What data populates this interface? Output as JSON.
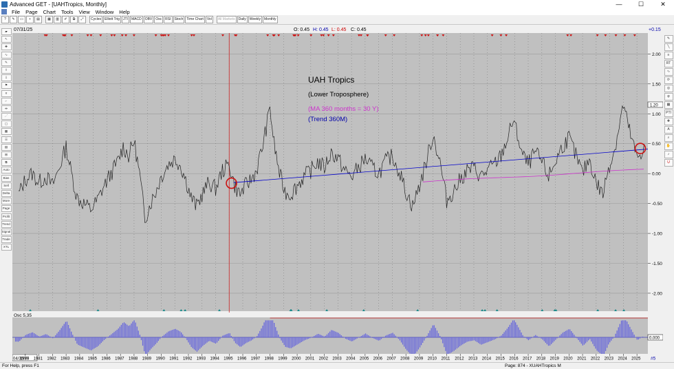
{
  "window": {
    "title": "Advanced GET - [UAHTropics, Monthly]",
    "minimize": "—",
    "maximize": "☐",
    "close": "✕"
  },
  "menu": [
    "File",
    "Page",
    "Chart",
    "Tools",
    "View",
    "Window",
    "Help"
  ],
  "toolbar": [
    "Cycles",
    "Elliott Trig",
    "JTI",
    "MACD",
    "OBV",
    "Osc",
    "RSI",
    "Stoch",
    "Time Chart",
    "Vol",
    "All Markets",
    "Daily",
    "Weekly",
    "Monthly"
  ],
  "left_tools": [
    "Auto Trend",
    "Bias",
    "Sell Stat",
    "Delta",
    "More Arrs",
    "Page",
    "Profit",
    "Trend Chan",
    "Signal Trade",
    "Trade Profile",
    "XTL"
  ],
  "right_tools": [
    "RT",
    "PTI",
    "A"
  ],
  "header": {
    "date": "07/31/25",
    "open": "O: 0.45",
    "high": "H: 0.45",
    "low": "L: 0.45",
    "close": "C: 0.45",
    "change": "+0.15"
  },
  "annotations": {
    "title": "UAH Tropics",
    "subtitle": "(Lower Troposphere)",
    "ma_label": "(MA 360 months = 30 Y)",
    "trend_label": "(Trend 360M)"
  },
  "price_axis": [
    "2.00",
    "1.50",
    "1.00",
    "0.50",
    "0.00",
    "-0.50",
    "-1.00",
    "-1.50",
    "-2.00"
  ],
  "price_marker": "1.20",
  "osc": {
    "label": "Osc 5,35",
    "axis_label": "0.000"
  },
  "time_axis": {
    "start": "04/30/79",
    "years": [
      "1980",
      "1981",
      "1982",
      "1983",
      "1984",
      "1985",
      "1986",
      "1987",
      "1988",
      "1989",
      "1990",
      "1991",
      "1992",
      "1993",
      "1994",
      "1995",
      "1996",
      "1997",
      "1998",
      "1999",
      "2000",
      "2001",
      "2002",
      "2003",
      "2004",
      "2005",
      "2006",
      "2007",
      "2008",
      "2009",
      "2010",
      "2011",
      "2012",
      "2013",
      "2014",
      "2015",
      "2016",
      "2017",
      "2018",
      "2019",
      "2020",
      "2021",
      "2022",
      "2023",
      "2024",
      "2025"
    ],
    "page_number": "#5"
  },
  "status": {
    "help": "For Help, press F1",
    "page": "Page: 874 - XUAHTropics M"
  },
  "colors": {
    "chart_bg": "#c0c0c0",
    "price_line": "#202020",
    "trend": "#0000cc",
    "ma": "#cc33cc",
    "cursor": "#cc2222",
    "osc_bar": "#6666dd",
    "osc_line": "#cc2222",
    "marker_red": "#cc1111",
    "marker_teal": "#1a8a8a"
  },
  "chart_data": {
    "type": "line",
    "ylim": [
      -2.3,
      2.35
    ],
    "xlim": [
      "1979-04",
      "2025-07"
    ],
    "trend_line": {
      "x": [
        "1995-05",
        "2025-07"
      ],
      "y": [
        -0.15,
        0.36
      ]
    },
    "ma_line": {
      "x": [
        "2009-04",
        "2025-07"
      ],
      "y": [
        -0.14,
        0.07
      ]
    },
    "cursor_date": "1995-01",
    "highlight_circles": [
      {
        "x": "1995-03",
        "y": -0.16
      },
      {
        "x": "2025-04",
        "y": 0.42
      }
    ],
    "x": [
      1979.5,
      1980.0,
      1980.5,
      1981.0,
      1981.5,
      1982.0,
      1982.5,
      1983.0,
      1983.4,
      1983.8,
      1984.3,
      1984.8,
      1985.3,
      1985.8,
      1986.3,
      1986.8,
      1987.2,
      1987.6,
      1988.0,
      1988.4,
      1988.8,
      1989.2,
      1989.6,
      1990.0,
      1990.5,
      1991.0,
      1991.4,
      1991.8,
      1992.2,
      1992.6,
      1993.0,
      1993.5,
      1994.0,
      1994.5,
      1995.0,
      1995.4,
      1995.8,
      1996.2,
      1996.6,
      1997.0,
      1997.4,
      1997.8,
      1998.0,
      1998.3,
      1998.7,
      1999.1,
      1999.5,
      2000.0,
      2000.5,
      2001.0,
      2001.5,
      2002.0,
      2002.5,
      2003.0,
      2003.5,
      2004.0,
      2004.5,
      2005.0,
      2005.5,
      2006.0,
      2006.5,
      2007.0,
      2007.5,
      2008.0,
      2008.5,
      2009.0,
      2009.5,
      2010.0,
      2010.5,
      2011.0,
      2011.5,
      2012.0,
      2012.5,
      2013.0,
      2013.5,
      2014.0,
      2014.5,
      2015.0,
      2015.5,
      2015.9,
      2016.2,
      2016.6,
      2017.0,
      2017.5,
      2018.0,
      2018.5,
      2019.0,
      2019.5,
      2020.0,
      2020.5,
      2021.0,
      2021.5,
      2022.0,
      2022.5,
      2022.9,
      2023.3,
      2023.7,
      2024.0,
      2024.3,
      2024.7,
      2025.0,
      2025.3,
      2025.6
    ],
    "y": [
      -0.35,
      -0.1,
      0.0,
      -0.15,
      -0.05,
      -0.2,
      0.1,
      0.45,
      0.0,
      -0.4,
      -0.5,
      -0.6,
      -0.45,
      -0.2,
      0.0,
      0.2,
      0.45,
      0.3,
      0.55,
      0.0,
      -0.75,
      -0.5,
      -0.3,
      -0.05,
      0.15,
      0.25,
      0.15,
      -0.1,
      -0.4,
      -0.55,
      -0.35,
      -0.15,
      -0.25,
      0.05,
      0.15,
      -0.2,
      -0.35,
      -0.2,
      -0.1,
      0.05,
      0.4,
      0.85,
      1.1,
      0.5,
      0.0,
      -0.3,
      -0.35,
      -0.2,
      -0.05,
      0.05,
      0.2,
      0.1,
      0.35,
      0.25,
      0.05,
      -0.05,
      0.1,
      0.25,
      0.1,
      0.0,
      0.2,
      0.3,
      0.05,
      -0.3,
      -0.55,
      -0.2,
      0.2,
      0.65,
      0.2,
      -0.45,
      -0.3,
      -0.1,
      0.05,
      0.1,
      -0.05,
      0.05,
      0.15,
      0.3,
      0.6,
      0.9,
      0.65,
      0.3,
      0.15,
      0.35,
      0.2,
      -0.05,
      0.2,
      0.45,
      0.6,
      0.3,
      0.0,
      0.25,
      -0.15,
      -0.35,
      0.1,
      0.35,
      0.8,
      1.15,
      0.85,
      0.5,
      0.25,
      0.35,
      0.45
    ],
    "osc_series": {
      "name": "Osc 5,35",
      "ylim": [
        -0.6,
        0.6
      ]
    }
  }
}
